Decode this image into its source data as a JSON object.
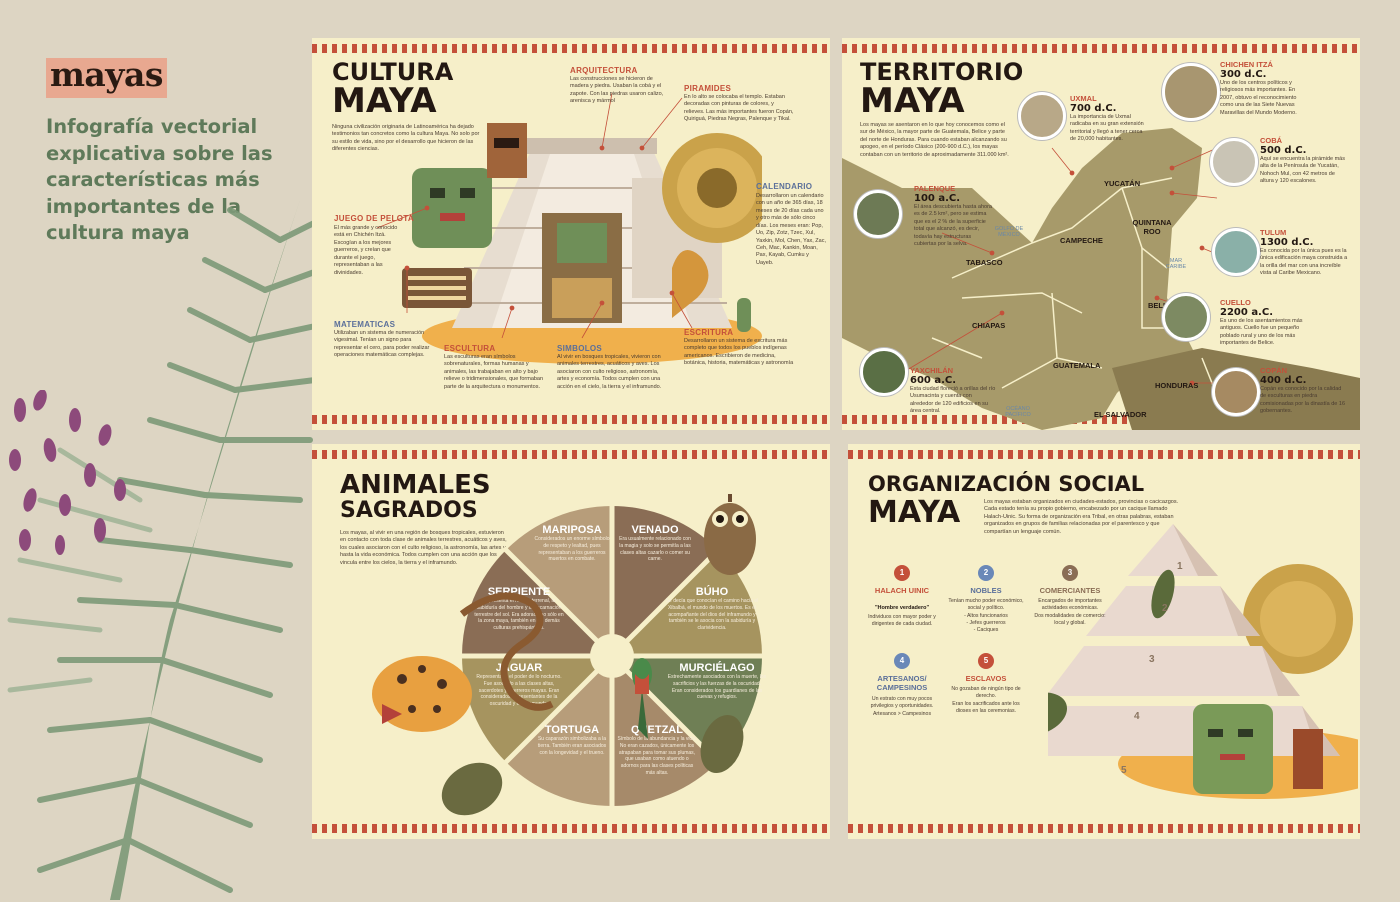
{
  "header": {
    "logo": "mayas",
    "subtitle": "Infografía vectorial explicativa sobre las características más importantes de la cultura maya"
  },
  "cultura": {
    "title1": "CULTURA",
    "title2": "MAYA",
    "intro": "Ninguna civilización originaria de Latinoamérica ha dejado testimonios tan concretos como la cultura Maya. No solo por su estilo de vida, sino por el desarrollo que hicieron de las diferentes ciencias.",
    "arquitectura": {
      "label": "ARQUITECTURA",
      "text": "Las construcciones se hicieron de madera y piedra. Usaban la cobá y el zapote. Con las piedras usaron calizo, arenisca y mármol"
    },
    "piramides": {
      "label": "PIRAMIDES",
      "text": "En lo alto se colocaba el templo. Estaban decoradas con pinturas de colores, y relieves. Las más importantes fueron Copán, Quiriguá, Piedras Negras, Palenque y Tikal."
    },
    "juego": {
      "label": "JUEGO DE PELOTA",
      "text": "El más grande y conocido está en Chichén Itzá. Escogían a los mejores guerreros, y creían que durante el juego, representaban a las divinidades."
    },
    "calendario": {
      "label": "CALENDARIO",
      "text": "Desarrollaron un calendario con un año de 365 días, 18 meses de 20 días cada uno y otro más de sólo cinco días. Los meses eran: Pop, Uo, Zip, Zotz, Tzec, Xul, Yaxkin, Mol, Chen, Yax, Zac, Ceh, Mac, Kankin, Moan, Pax, Kayab, Cumku y Uayeb."
    },
    "matematicas": {
      "label": "MATEMATICAS",
      "text": "Utilizaban un sistema de numeración vigesimal. Tenían un signo para representar el cero, para poder realizar operaciones matemáticas complejas."
    },
    "escultura": {
      "label": "ESCULTURA",
      "text": "Las esculturas eran símbolos sobrenaturales, formas humanas y animales, las trabajaban en alto y bajo relieve o tridimensionales, que formaban parte de la arquitectura o monumentos."
    },
    "simbolos": {
      "label": "SIMBOLOS",
      "text": "Al vivir en bosques tropicales, vivieron con animales terrestres, acuáticos y aves. Los asociaron con culto religioso, astronomía, artes y economía. Todos cumplen con una acción en el cielo, la tierra y el inframundo."
    },
    "escritura": {
      "label": "ESCRITURA",
      "text": "Desarrollaron un sistema de escritura más completo que todos los pueblos indígenas americanos. Escribieron de medicina, botánica, historia, matemáticas y astronomía"
    }
  },
  "territorio": {
    "title1": "TERRITORIO",
    "title2": "MAYA",
    "intro": "Los mayas se asentaron en lo que hoy conocemos como el sur de México, la mayor parte de Guatemala, Belice y parte del norte de Honduras. Para cuando estaban alcanzando su apogeo, en el período Clásico (200-900 d.C.), los mayas contaban con un territorio de aproximadamente 311.000 km².",
    "regions": [
      "YUCATÁN",
      "QUINTANA ROO",
      "CAMPECHE",
      "TABASCO",
      "CHIAPAS",
      "BELICE",
      "GUATEMALA",
      "HONDURAS",
      "EL SALVADOR"
    ],
    "seas": [
      "GOLFO DE MÉXICO",
      "MAR CARIBE",
      "OCÉANO PACÍFICO"
    ],
    "sites": [
      {
        "name": "UXMAL",
        "year": "700 d.C.",
        "text": "La importancia de Uxmal radicaba en su gran extensión territorial y llegó a tener cerca de 20,000 habitantes."
      },
      {
        "name": "CHICHEN ITZÁ",
        "year": "300 d.C.",
        "text": "Uno de los centros políticos y religiosos más importantes. En 2007, obtuvo el reconocimiento como una de las Siete Nuevas Maravillas del Mundo Moderno."
      },
      {
        "name": "PALENQUE",
        "year": "100 a.C.",
        "text": "El área descubierta hasta ahora es de 2.5 km², pero se estima que es el 2 % de la superficie total que alcanzó, es decir, todavía hay estructuras cubiertas por la selva."
      },
      {
        "name": "COBÁ",
        "year": "500 d.C.",
        "text": "Aquí se encuentra la pirámide más alta de la Península de Yucatán, Nohoch Mul, con 42 metros de altura y 120 escalones."
      },
      {
        "name": "TULUM",
        "year": "1300 d.C.",
        "text": "Es conocida por la única pues es la única edificación maya construida a la orilla del mar con una increíble vista al Caribe Mexicano."
      },
      {
        "name": "CUELLO",
        "year": "2200 a.C.",
        "text": "Es uno de los asentamientos más antiguos. Cuello fue un pequeño poblado rural y uno de los más importantes de Belice."
      },
      {
        "name": "YAXCHILÁN",
        "year": "600 a.C.",
        "text": "Esta ciudad floreció a orillas del río Usumacinta y cuenta con alrededor de 120 edificios en su área central."
      },
      {
        "name": "COPÁN",
        "year": "400 d.C.",
        "text": "Copán es conocido por la calidad de esculturas en piedra comisionadas por la dinastía de 16 gobernantes."
      }
    ]
  },
  "animales": {
    "title1": "ANIMALES",
    "title2": "SAGRADOS",
    "intro": "Los mayas, al vivir en una región de bosques tropicales, estuvieron en contacto con toda clase de animales terrestres, acuáticos y aves, los cuales asociaron con el culto religioso, la astronomía, las artes y hasta la vida económica. Todos cumplen con una acción que los vincula entre los cielos, la tierra y el inframundo.",
    "items": [
      {
        "name": "MARIPOSA",
        "text": "Considerados un enorme símbolo de respeto y lealtad, pues representaban a los guerreros muertos en combate."
      },
      {
        "name": "VENADO",
        "text": "Era usualmente relacionado con la magia y solo se permitía a las clases altas cazarlo o comer su carne."
      },
      {
        "name": "SERPIENTE",
        "text": "Representa el mundo terrenal, la sabiduría del hombre y la encarnación terrestre del sol. Era adorado no sólo en la zona maya, también en las demás culturas prehispánicas."
      },
      {
        "name": "BÚHO",
        "text": "Se decía que conocían el camino hacia el Xibalbá, el mundo de los muertos. Es el acompañante del dios del inframundo y también se le asocia con la sabiduría y clarividencia."
      },
      {
        "name": "JAGUAR",
        "text": "Representaba el poder de lo nocturno. Fue asociado a las clases altas, sacerdotes y guerreros mayas. Eran considerados representantes de la oscuridad y el inframundo."
      },
      {
        "name": "MURCIÉLAGO",
        "text": "Estrechamente asociados con la muerte, los sacrificios y las fuerzas de la oscuridad. Eran considerados los guardianes de las cuevas y refugios."
      },
      {
        "name": "TORTUGA",
        "text": "Su caparazón simbolizaba a la tierra. También eran asociados con la longevidad y el trueno."
      },
      {
        "name": "QUETZAL",
        "text": "Símbolo de la abundancia y la vida. No eran cazados, únicamente los atrapaban para tomar sus plumas, que usaban como atuendo o adornos para las clases políticas más altas."
      }
    ]
  },
  "organizacion": {
    "title1": "ORGANIZACIÓN SOCIAL",
    "title2": "MAYA",
    "intro": "Los mayas estaban organizados en ciudades-estados, provincias o cacicazgos. Cada estado tenía su propio gobierno, encabezado por un cacique llamado Halach-Uinic. Su forma de organización era Tribal, en otras palabras, estaban organizados en grupos de familias relacionadas por el parentesco y que compartían un lenguaje común.",
    "groups": [
      {
        "num": "1",
        "name": "HALACH UINIC",
        "sub": "\"Hombre verdadero\"",
        "text": "Individuos con mayor poder y dirigentes de cada ciudad."
      },
      {
        "num": "2",
        "name": "NOBLES",
        "sub": "",
        "text": "Tenían mucho poder económico, social y político.\n- Altos funcionarios\n- Jefes guerreros\n- Caciques"
      },
      {
        "num": "3",
        "name": "COMERCIANTES",
        "sub": "",
        "text": "Encargados de importantes actividades económicas.\nDos modalidades de comercio: local y global."
      },
      {
        "num": "4",
        "name": "ARTESANOS/ CAMPESINOS",
        "sub": "",
        "text": "Un estrato con muy pocos privilegios y oportunidades.\nArtesanos > Campesinos"
      },
      {
        "num": "5",
        "name": "ESCLAVOS",
        "sub": "",
        "text": "No gozaban de ningún tipo de derecho.\nEran los sacrificados ante los dioses en las ceremonias."
      }
    ],
    "levels": [
      "1",
      "2",
      "3",
      "4",
      "5"
    ]
  },
  "colors": {
    "red": "#c4503a",
    "blue": "#5a6f9a",
    "purple": "#8a4a7a",
    "olive": "#a79a6a",
    "brown": "#8a6d55",
    "green": "#7a9270"
  }
}
